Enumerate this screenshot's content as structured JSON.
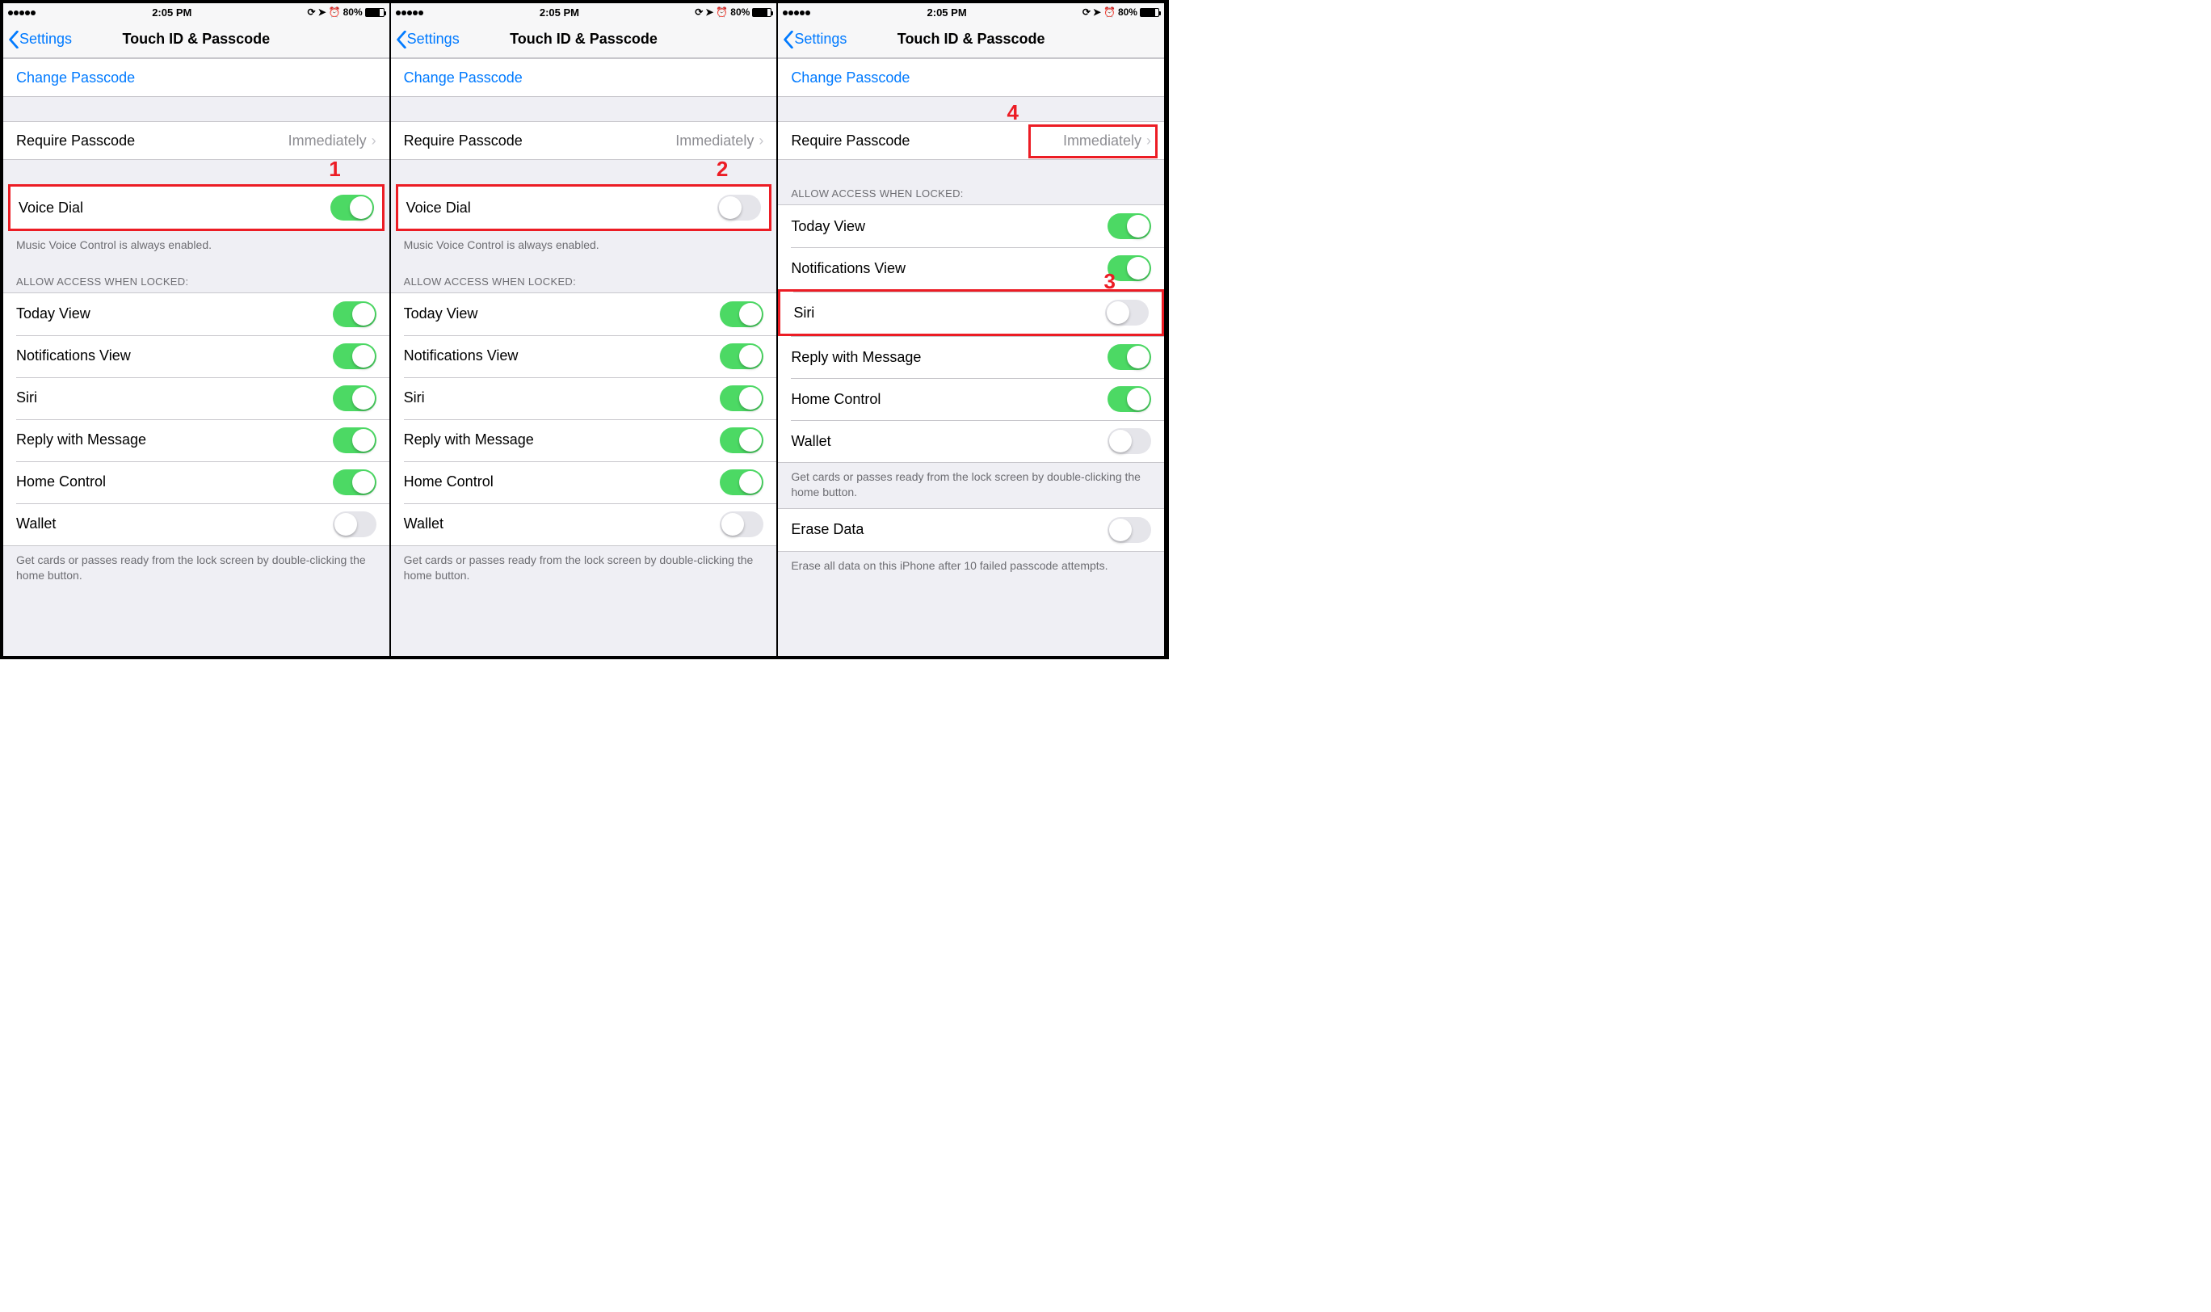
{
  "statusbar": {
    "time": "2:05 PM",
    "battery_pct": "80%"
  },
  "nav": {
    "back_label": "Settings",
    "title": "Touch ID & Passcode"
  },
  "rows": {
    "change_passcode": "Change Passcode",
    "require_passcode": "Require Passcode",
    "require_passcode_value": "Immediately",
    "voice_dial": "Voice Dial",
    "voice_dial_footer": "Music Voice Control is always enabled.",
    "allow_header": "ALLOW ACCESS WHEN LOCKED:",
    "today_view": "Today View",
    "notifications_view": "Notifications View",
    "siri": "Siri",
    "reply_with_message": "Reply with Message",
    "home_control": "Home Control",
    "wallet": "Wallet",
    "wallet_footer": "Get cards or passes ready from the lock screen by double-clicking the home button.",
    "erase_data": "Erase Data",
    "erase_data_footer": "Erase all data on this iPhone after 10 failed passcode attempts."
  },
  "annotations": {
    "n1": "1",
    "n2": "2",
    "n3": "3",
    "n4": "4"
  },
  "screens": [
    {
      "voice_dial_on": true,
      "toggles": {
        "today": true,
        "notif": true,
        "siri": true,
        "reply": true,
        "home": true,
        "wallet": false
      },
      "show_voice_dial": true,
      "show_erase": false,
      "ann_voice_dial": "1",
      "ann_siri": null,
      "ann_require": null
    },
    {
      "voice_dial_on": false,
      "toggles": {
        "today": true,
        "notif": true,
        "siri": true,
        "reply": true,
        "home": true,
        "wallet": false
      },
      "show_voice_dial": true,
      "show_erase": false,
      "ann_voice_dial": "2",
      "ann_siri": null,
      "ann_require": null
    },
    {
      "voice_dial_on": null,
      "toggles": {
        "today": true,
        "notif": true,
        "siri": false,
        "reply": true,
        "home": true,
        "wallet": false
      },
      "show_voice_dial": false,
      "show_erase": true,
      "ann_voice_dial": null,
      "ann_siri": "3",
      "ann_require": "4"
    }
  ]
}
